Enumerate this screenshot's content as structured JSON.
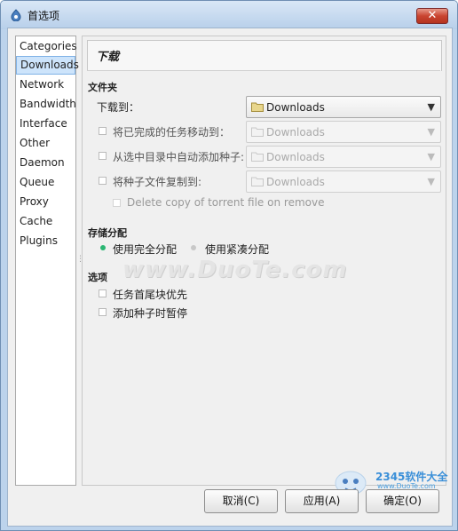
{
  "window": {
    "title": "首选项",
    "close_label": "✕"
  },
  "categories": {
    "header": "Categories",
    "items": [
      "Downloads",
      "Network",
      "Bandwidth",
      "Interface",
      "Other",
      "Daemon",
      "Queue",
      "Proxy",
      "Cache",
      "Plugins"
    ],
    "selected": "Downloads"
  },
  "page": {
    "title": "下载"
  },
  "folders": {
    "section": "文件夹",
    "download_to_label": "下载到：",
    "download_to_value": "Downloads",
    "move_completed_label": "将已完成的任务移动到：",
    "move_completed_value": "Downloads",
    "autoadd_label": "从选中目录中自动添加种子:",
    "autoadd_value": "Downloads",
    "copy_torrent_label": "将种子文件复制到:",
    "copy_torrent_value": "Downloads",
    "delete_copy_label": "Delete copy of torrent file on remove"
  },
  "allocation": {
    "section": "存储分配",
    "full_label": "使用完全分配",
    "compact_label": "使用紧凑分配",
    "selected": "full"
  },
  "options": {
    "section": "选项",
    "prioritize_label": "任务首尾块优先",
    "add_paused_label": "添加种子时暂停"
  },
  "buttons": {
    "cancel": "取消(C)",
    "apply": "应用(A)",
    "ok": "确定(O)"
  },
  "watermark": "www.DuoTe.com",
  "logo": {
    "name": "2345软件大全",
    "url": "www.DuoTe.com"
  },
  "colors": {
    "accent": "#3c6eb4",
    "radio_selected": "#2bb673",
    "radio_unselected": "#c8c8c8"
  }
}
